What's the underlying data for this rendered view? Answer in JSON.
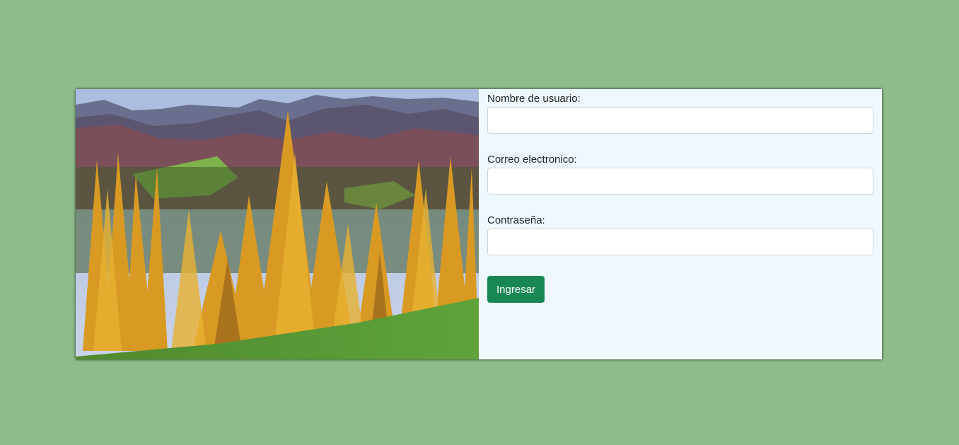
{
  "form": {
    "username_label": "Nombre de usuario:",
    "username_value": "",
    "email_label": "Correo electronico:",
    "email_value": "",
    "password_label": "Contraseña:",
    "password_value": "",
    "submit_label": "Ingresar"
  },
  "colors": {
    "page_background": "#8fbc8b",
    "form_background": "#f0f8ff",
    "button": "#198754"
  }
}
